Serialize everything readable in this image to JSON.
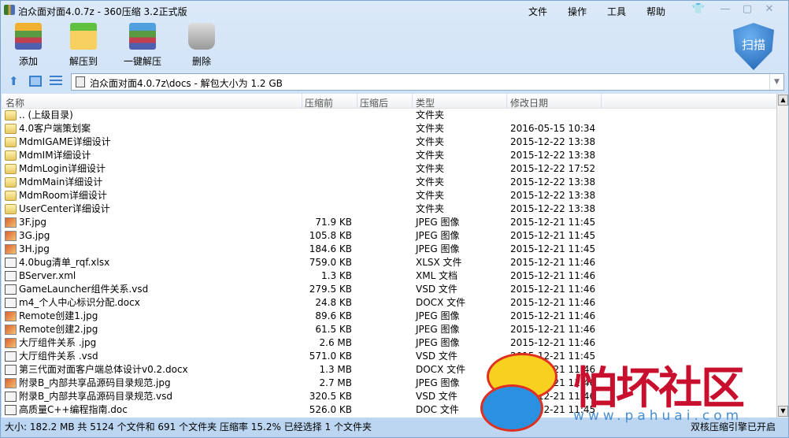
{
  "window": {
    "title": "泊众面对面4.0.7z - 360压缩 3.2正式版"
  },
  "menu": [
    "文件",
    "操作",
    "工具",
    "帮助"
  ],
  "toolbar": [
    {
      "label": "添加",
      "icon": "add-archive-icon"
    },
    {
      "label": "解压到",
      "icon": "extract-to-icon"
    },
    {
      "label": "一键解压",
      "icon": "quick-extract-icon"
    },
    {
      "label": "删除",
      "icon": "delete-icon"
    }
  ],
  "scan": {
    "label": "扫描"
  },
  "path": {
    "value": "泊众面对面4.0.7z\\docs - 解包大小为 1.2 GB"
  },
  "columns": [
    "名称",
    "压缩前",
    "压缩后",
    "类型",
    "修改日期"
  ],
  "files": [
    {
      "name": ".. (上级目录)",
      "size": "",
      "type": "文件夹",
      "date": "",
      "kind": "folder"
    },
    {
      "name": "4.0客户端策划案",
      "size": "",
      "type": "文件夹",
      "date": "2016-05-15 10:34",
      "kind": "folder"
    },
    {
      "name": "MdmIGAME详细设计",
      "size": "",
      "type": "文件夹",
      "date": "2015-12-22 13:38",
      "kind": "folder"
    },
    {
      "name": "MdmIM详细设计",
      "size": "",
      "type": "文件夹",
      "date": "2015-12-22 13:38",
      "kind": "folder"
    },
    {
      "name": "MdmLogin详细设计",
      "size": "",
      "type": "文件夹",
      "date": "2015-12-22 17:52",
      "kind": "folder"
    },
    {
      "name": "MdmMain详细设计",
      "size": "",
      "type": "文件夹",
      "date": "2015-12-22 13:38",
      "kind": "folder"
    },
    {
      "name": "MdmRoom详细设计",
      "size": "",
      "type": "文件夹",
      "date": "2015-12-22 13:38",
      "kind": "folder"
    },
    {
      "name": "UserCenter详细设计",
      "size": "",
      "type": "文件夹",
      "date": "2015-12-22 13:38",
      "kind": "folder"
    },
    {
      "name": "3F.jpg",
      "size": "71.9 KB",
      "type": "JPEG 图像",
      "date": "2015-12-21 11:45",
      "kind": "image"
    },
    {
      "name": "3G.jpg",
      "size": "105.8 KB",
      "type": "JPEG 图像",
      "date": "2015-12-21 11:45",
      "kind": "image"
    },
    {
      "name": "3H.jpg",
      "size": "184.6 KB",
      "type": "JPEG 图像",
      "date": "2015-12-21 11:45",
      "kind": "image"
    },
    {
      "name": "4.0bug清单_rqf.xlsx",
      "size": "759.0 KB",
      "type": "XLSX 文件",
      "date": "2015-12-21 11:46",
      "kind": "doc"
    },
    {
      "name": "BServer.xml",
      "size": "1.3 KB",
      "type": "XML 文档",
      "date": "2015-12-21 11:46",
      "kind": "doc"
    },
    {
      "name": "GameLauncher组件关系.vsd",
      "size": "279.5 KB",
      "type": "VSD 文件",
      "date": "2015-12-21 11:46",
      "kind": "doc"
    },
    {
      "name": "m4_个人中心标识分配.docx",
      "size": "24.8 KB",
      "type": "DOCX 文件",
      "date": "2015-12-21 11:46",
      "kind": "doc"
    },
    {
      "name": "Remote创建1.jpg",
      "size": "89.6 KB",
      "type": "JPEG 图像",
      "date": "2015-12-21 11:46",
      "kind": "image"
    },
    {
      "name": "Remote创建2.jpg",
      "size": "61.5 KB",
      "type": "JPEG 图像",
      "date": "2015-12-21 11:46",
      "kind": "image"
    },
    {
      "name": "大厅组件关系 .jpg",
      "size": "2.6 MB",
      "type": "JPEG 图像",
      "date": "2015-12-21 11:46",
      "kind": "image"
    },
    {
      "name": "大厅组件关系 .vsd",
      "size": "571.0 KB",
      "type": "VSD 文件",
      "date": "2015-12-21 11:45",
      "kind": "doc"
    },
    {
      "name": "第三代面对面客户端总体设计v0.2.docx",
      "size": "1.3 MB",
      "type": "DOCX 文件",
      "date": "2015-12-21 11:46",
      "kind": "doc"
    },
    {
      "name": "附录B_内部共享品源码目录规范.jpg",
      "size": "2.7 MB",
      "type": "JPEG 图像",
      "date": "2015-12-21 11:46",
      "kind": "image"
    },
    {
      "name": "附录B_内部共享品源码目录规范.vsd",
      "size": "320.5 KB",
      "type": "VSD 文件",
      "date": "2015-12-21 11:46",
      "kind": "doc"
    },
    {
      "name": "高质量C++编程指南.doc",
      "size": "526.0 KB",
      "type": "DOC 文件",
      "date": "2015-12-21 11:45",
      "kind": "doc"
    }
  ],
  "status": {
    "summary": "大小: 182.2 MB 共 5124 个文件和 691 个文件夹 压缩率 15.2% 已经选择 1 个文件夹",
    "engine": "双核压缩引擎已开启"
  },
  "watermark": {
    "text": "怕坏社区",
    "url": "www.pahuai.com"
  },
  "colors": {
    "accent": "#1c5fb0",
    "watermark": "#c8102e"
  }
}
